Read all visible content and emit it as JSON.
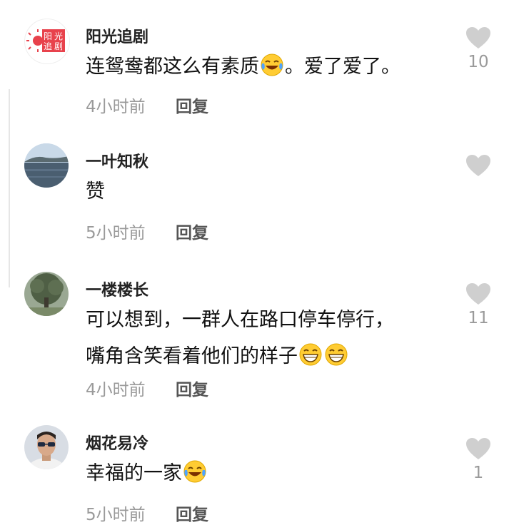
{
  "comments": [
    {
      "user": "阳光追剧",
      "avatar_text": [
        "阳",
        "光",
        "追",
        "剧"
      ],
      "lines": [
        "连鸳鸯都这么有素质",
        "。爱了爱了。"
      ],
      "emojis": [
        "laughing-tears"
      ],
      "time": "4小时前",
      "reply": "回复",
      "likes": "10"
    },
    {
      "user": "一叶知秋",
      "lines": [
        "赞"
      ],
      "time": "5小时前",
      "reply": "回复",
      "likes": ""
    },
    {
      "user": "一楼楼长",
      "lines": [
        "可以想到，一群人在路口停车停行，",
        "嘴角含笑看着他们的样子"
      ],
      "emojis": [
        "grinning",
        "grinning"
      ],
      "time": "4小时前",
      "reply": "回复",
      "likes": "11"
    },
    {
      "user": "烟花易冷",
      "lines": [
        "幸福的一家"
      ],
      "emojis": [
        "laughing-tears"
      ],
      "time": "5小时前",
      "reply": "回复",
      "likes": "1"
    }
  ],
  "colors": {
    "heart": "#cfcfcf",
    "meta_text": "#9a9a9a",
    "brand_red": "#e8424c"
  }
}
